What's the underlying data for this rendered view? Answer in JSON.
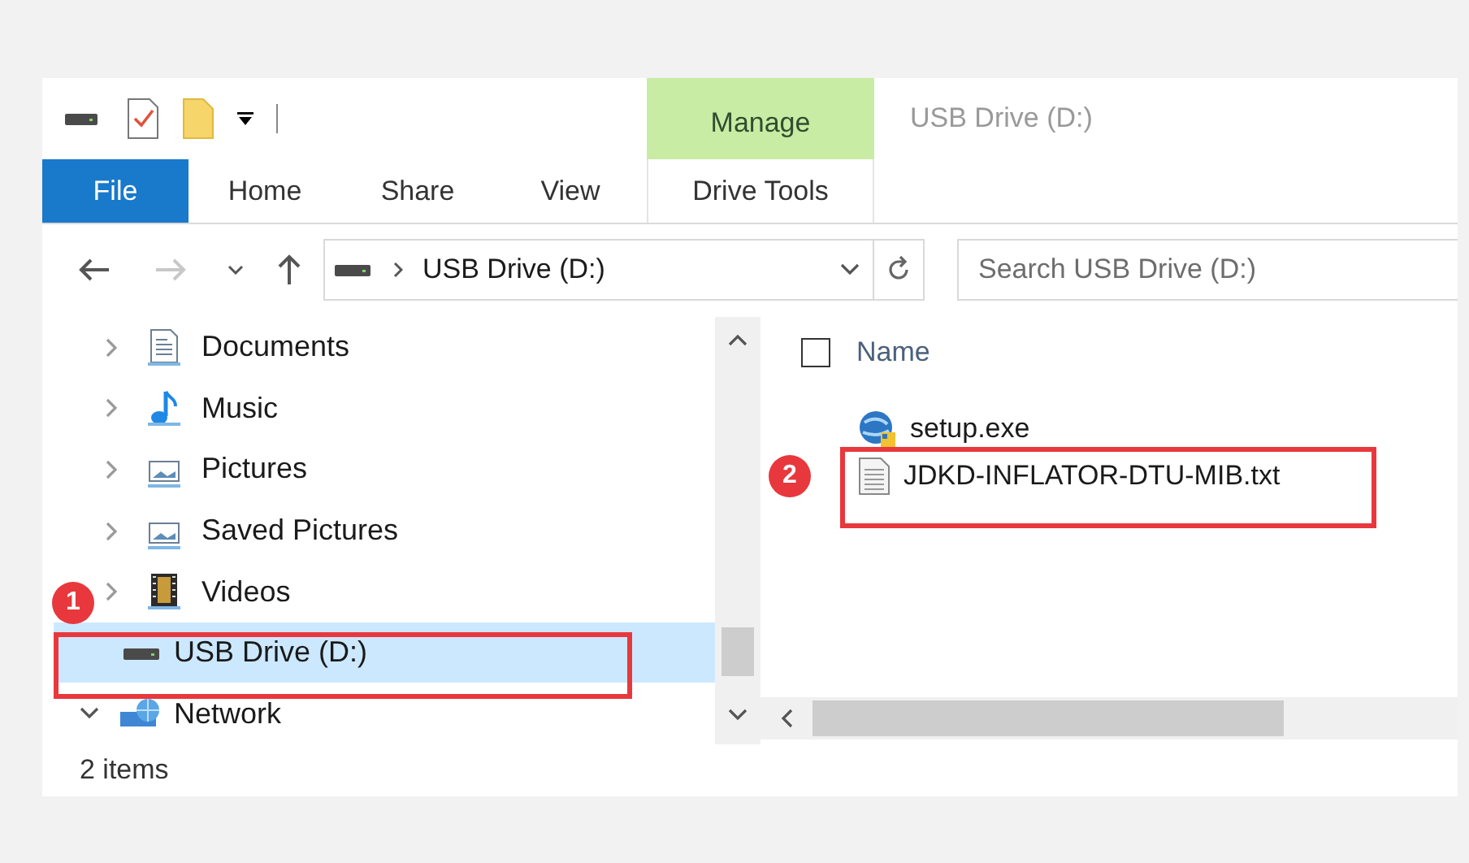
{
  "window": {
    "title": "USB Drive (D:)"
  },
  "ribbon": {
    "context_tab": {
      "label": "Manage"
    },
    "tabs": [
      {
        "label": "File",
        "kind": "file",
        "selected": false
      },
      {
        "label": "Home",
        "kind": "plain",
        "selected": false
      },
      {
        "label": "Share",
        "kind": "plain",
        "selected": false
      },
      {
        "label": "View",
        "kind": "plain",
        "selected": false
      },
      {
        "label": "Drive Tools",
        "kind": "context",
        "selected": false
      }
    ]
  },
  "address_bar": {
    "path": [
      "USB Drive (D:)"
    ]
  },
  "search": {
    "placeholder": "Search USB Drive (D:)"
  },
  "nav_pane": {
    "tree": [
      {
        "children": [
          {
            "label": "Documents",
            "kind": "documents",
            "expanded": false,
            "selected": false
          },
          {
            "label": "Music",
            "kind": "music",
            "expanded": false,
            "selected": false
          },
          {
            "label": "Pictures",
            "kind": "pictures",
            "expanded": false,
            "selected": false
          },
          {
            "label": "Saved Pictures",
            "kind": "pictures",
            "expanded": false,
            "selected": false
          },
          {
            "label": "Videos",
            "kind": "videos",
            "expanded": false,
            "selected": false
          }
        ]
      },
      {
        "label": "USB Drive (D:)",
        "kind": "drive",
        "selected": true,
        "callout": "1"
      },
      {
        "label": "Network",
        "kind": "network",
        "expanded": true,
        "selected": false
      }
    ]
  },
  "file_list": {
    "select_all": {
      "checked": false
    },
    "columns": [
      "Name"
    ],
    "files": [
      {
        "name": "setup.exe",
        "kind": "exe",
        "selected": false
      },
      {
        "name": "JDKD-INFLATOR-DTU-MIB.txt",
        "kind": "txt",
        "selected": false,
        "callout": "2"
      }
    ]
  },
  "status_bar": {
    "text": "2 items"
  }
}
